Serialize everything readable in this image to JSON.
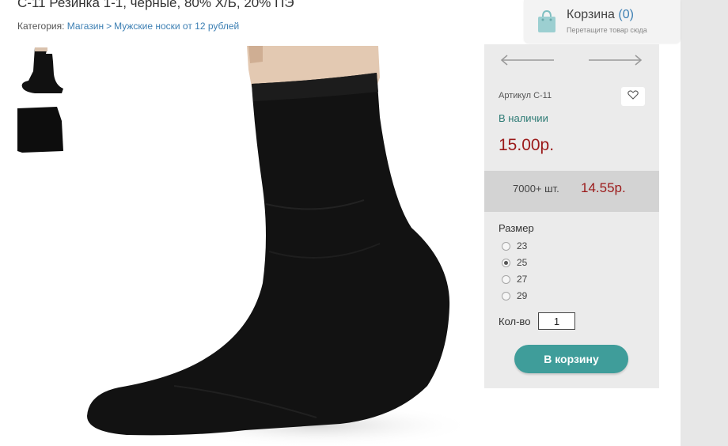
{
  "product": {
    "title": "С-11 Резинка 1-1, черные, 80% Х/Б, 20% ПЭ"
  },
  "breadcrumb": {
    "prefix": "Категория:",
    "items": [
      "Магазин",
      "Мужские носки от 12 рублей"
    ],
    "separator": ">"
  },
  "cart": {
    "label": "Корзина",
    "count": "(0)",
    "hint": "Перетащите товар сюда",
    "icon": "shopping-bag-icon",
    "icon_color": "#9ccfd1"
  },
  "panel": {
    "sku": "Артикул С-11",
    "stock": "В наличии",
    "price": "15.00р.",
    "bulk_qty": "7000+ шт.",
    "bulk_price": "14.55р.",
    "size_label": "Размер",
    "sizes": [
      "23",
      "25",
      "27",
      "29"
    ],
    "selected_size": "25",
    "qty_label": "Кол-во",
    "qty_value": "1",
    "add_button": "В корзину",
    "fav_icon": "heart-icon",
    "prev_icon": "arrow-left-icon",
    "next_icon": "arrow-right-icon"
  },
  "colors": {
    "accent": "#3f9d9a",
    "price": "#9b1a1a",
    "stock": "#2c7a74",
    "link": "#3c7fb3"
  }
}
